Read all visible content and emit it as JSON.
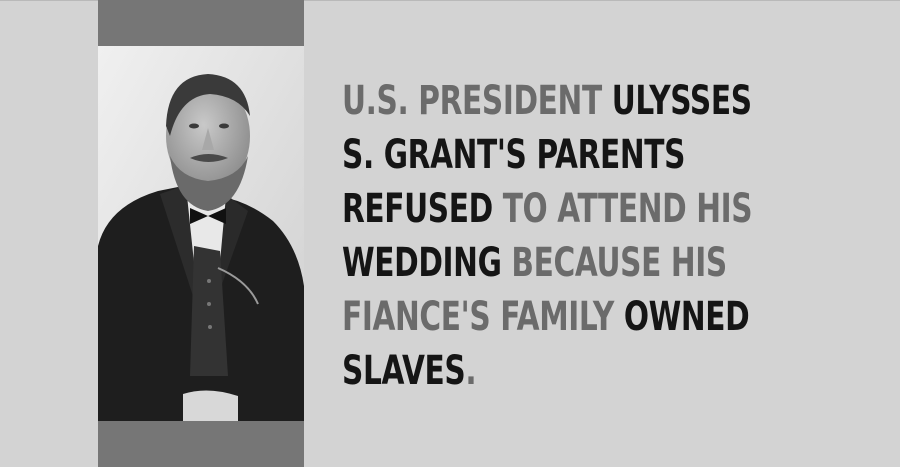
{
  "fact": {
    "lines": [
      [
        {
          "text": "U.S. PRESIDENT ",
          "style": "gray"
        },
        {
          "text": "ULYSSES",
          "style": "black"
        }
      ],
      [
        {
          "text": "S. GRANT'S PARENTS",
          "style": "black"
        }
      ],
      [
        {
          "text": "REFUSED ",
          "style": "black"
        },
        {
          "text": "TO ATTEND HIS",
          "style": "gray"
        }
      ],
      [
        {
          "text": "WEDDING ",
          "style": "black"
        },
        {
          "text": "BECAUSE HIS",
          "style": "gray"
        }
      ],
      [
        {
          "text": "FIANCE'S FAMILY ",
          "style": "gray"
        },
        {
          "text": "OWNED",
          "style": "black"
        }
      ],
      [
        {
          "text": "SLAVES",
          "style": "black"
        },
        {
          "text": ".",
          "style": "gray"
        }
      ]
    ]
  },
  "colors": {
    "background": "#d3d3d3",
    "bar": "#767676",
    "emphasis_text": "#151515",
    "muted_text": "#6b6b6b"
  },
  "portrait": {
    "subject": "black-and-white portrait photograph of a bearded man in a dark suit and bow tie"
  }
}
